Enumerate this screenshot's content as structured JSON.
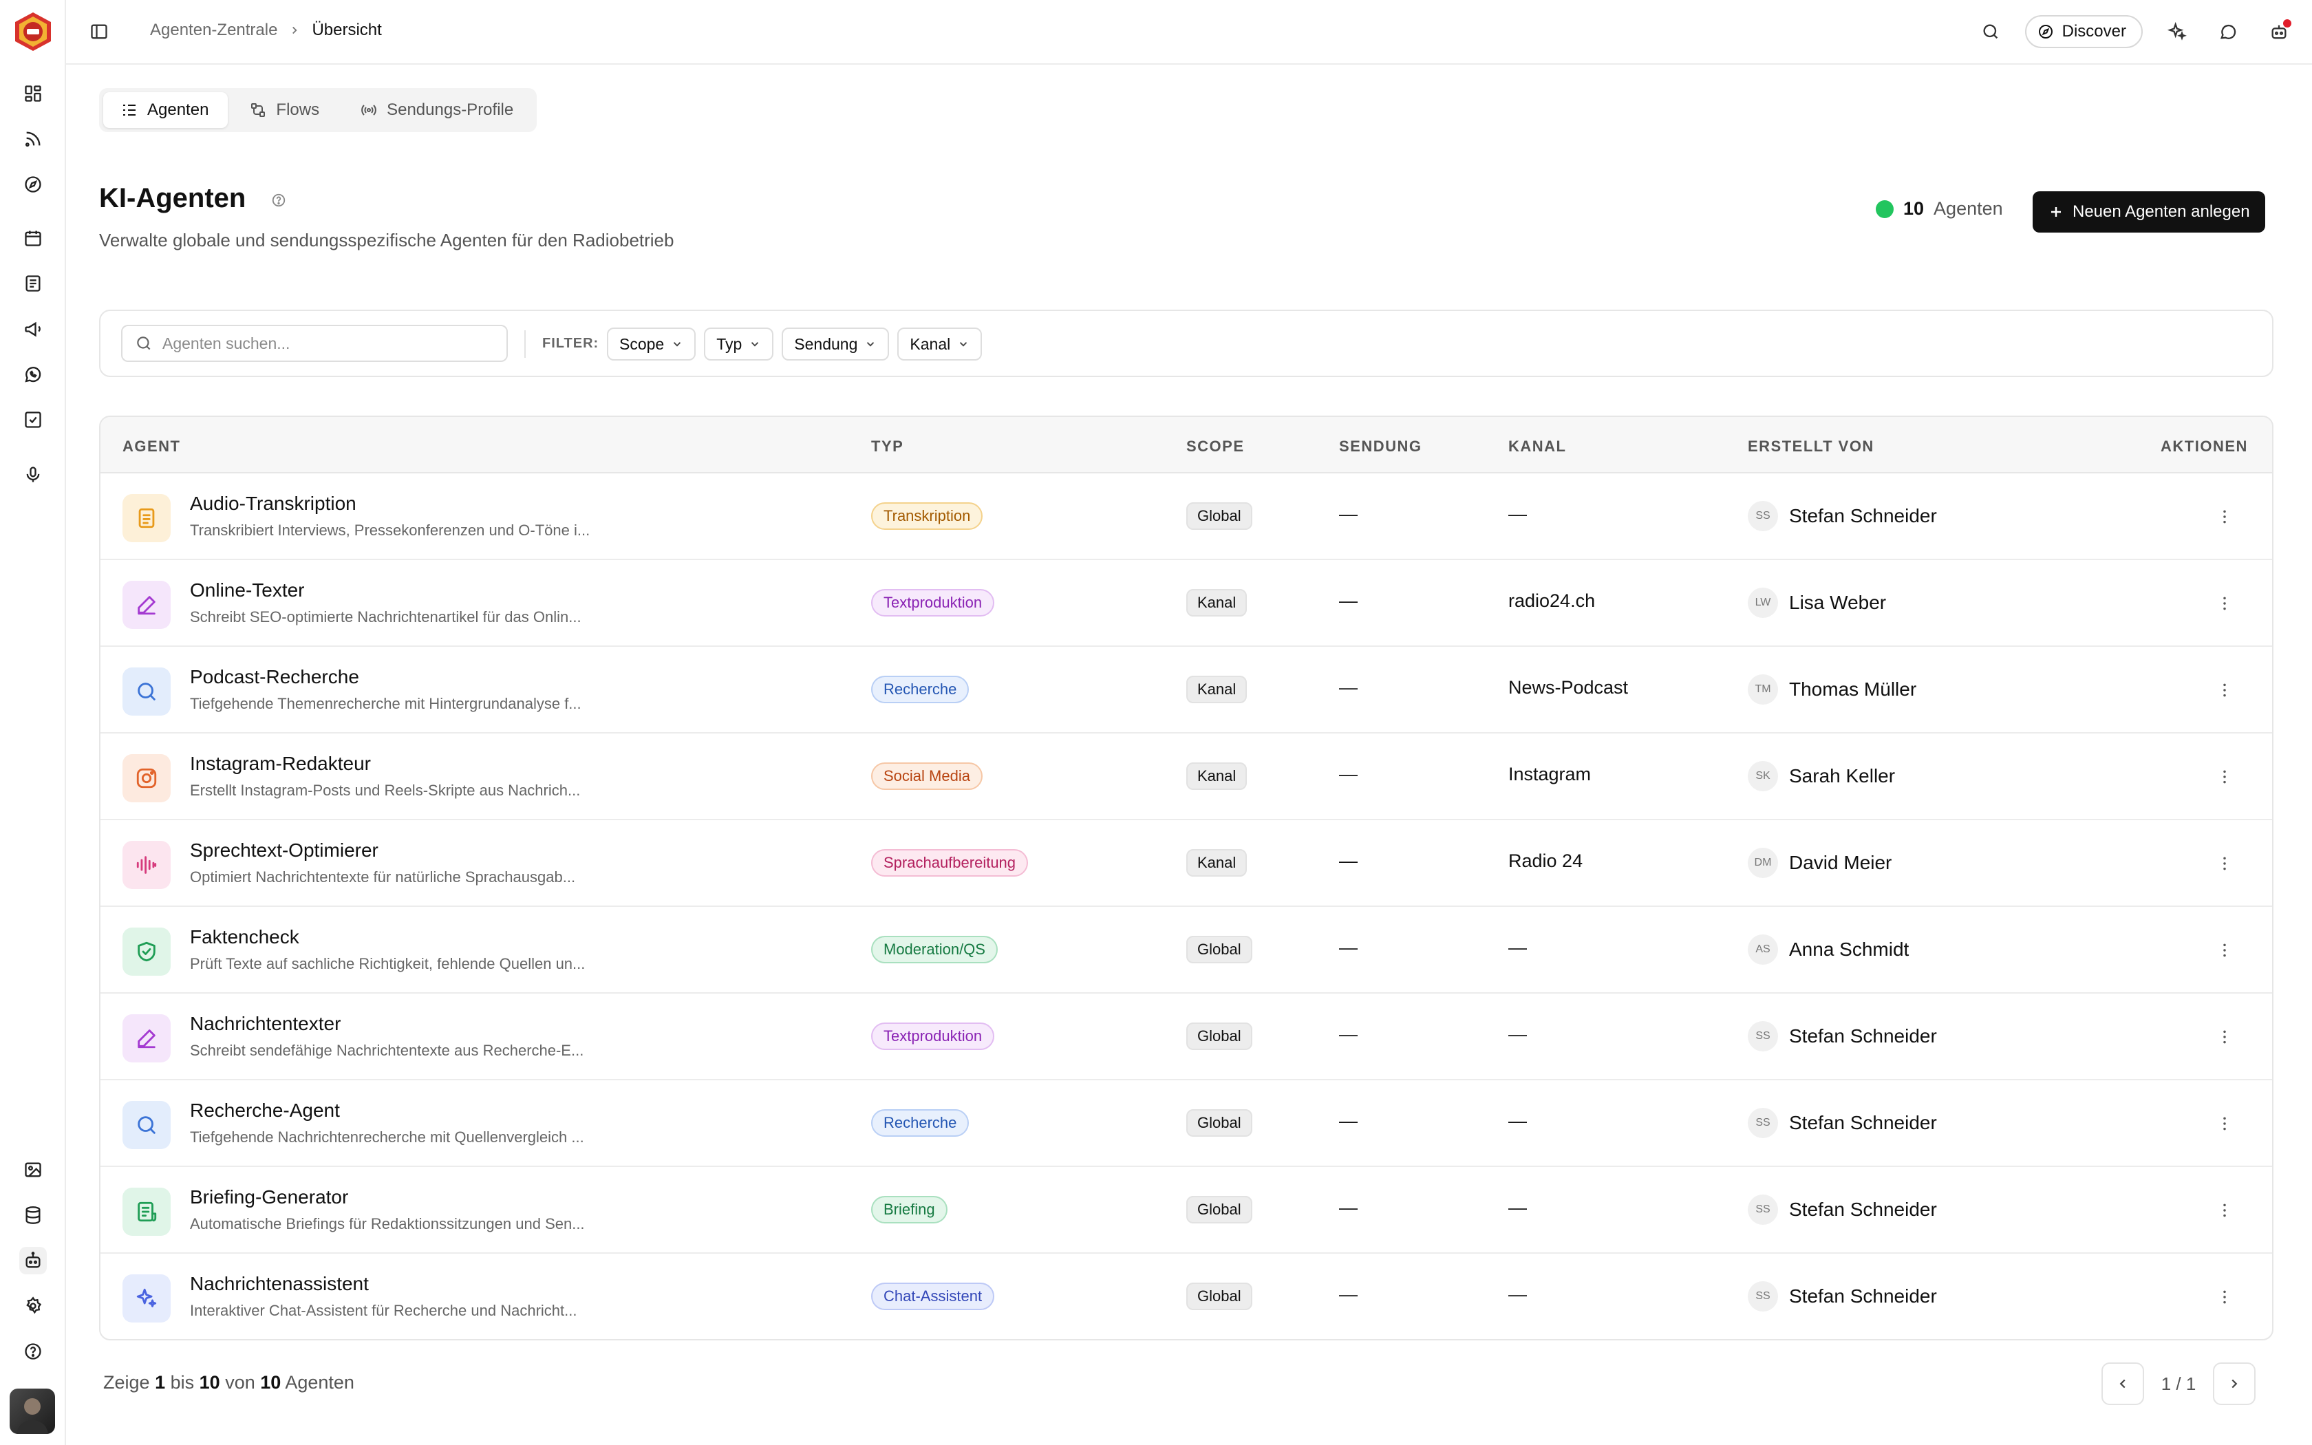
{
  "breadcrumb": {
    "parent": "Agenten-Zentrale",
    "current": "Übersicht"
  },
  "topbar": {
    "discover_label": "Discover"
  },
  "tabs": [
    {
      "label": "Agenten",
      "icon": "list-icon",
      "active": true
    },
    {
      "label": "Flows",
      "icon": "flow-icon",
      "active": false
    },
    {
      "label": "Sendungs-Profile",
      "icon": "broadcast-icon",
      "active": false
    }
  ],
  "header": {
    "title": "KI-Agenten",
    "subtitle": "Verwalte globale und sendungsspezifische Agenten für den Radiobetrieb",
    "count": "10",
    "count_label": "Agenten",
    "new_button": "Neuen Agenten anlegen"
  },
  "filters": {
    "search_placeholder": "Agenten suchen...",
    "label": "FILTER:",
    "chips": [
      "Scope",
      "Typ",
      "Sendung",
      "Kanal"
    ]
  },
  "table": {
    "columns": [
      "AGENT",
      "TYP",
      "SCOPE",
      "SENDUNG",
      "KANAL",
      "ERSTELLT VON",
      "AKTIONEN"
    ],
    "rows": [
      {
        "name": "Audio-Transkription",
        "desc": "Transkribiert Interviews, Pressekonferenzen und O-Töne i...",
        "icon": "document-icon",
        "icon_bg": "#fdf0d8",
        "icon_color": "#e89a1a",
        "type": "Transkription",
        "type_bg": "#fdf3dc",
        "type_border": "#f4d28c",
        "type_color": "#a35a00",
        "scope": "Global",
        "sendung": "—",
        "kanal": "—",
        "initials": "SS",
        "creator": "Stefan Schneider"
      },
      {
        "name": "Online-Texter",
        "desc": "Schreibt SEO-optimierte Nachrichtenartikel für das Onlin...",
        "icon": "pen-icon",
        "icon_bg": "#f5e6fb",
        "icon_color": "#a43ad1",
        "type": "Textproduktion",
        "type_bg": "#f7eafc",
        "type_border": "#e2bdf2",
        "type_color": "#8a23b4",
        "scope": "Kanal",
        "sendung": "—",
        "kanal": "radio24.ch",
        "initials": "LW",
        "creator": "Lisa Weber"
      },
      {
        "name": "Podcast-Recherche",
        "desc": "Tiefgehende Themenrecherche mit Hintergrundanalyse f...",
        "icon": "search-icon",
        "icon_bg": "#e3edfc",
        "icon_color": "#3b73d6",
        "type": "Recherche",
        "type_bg": "#e8f0fd",
        "type_border": "#b9cff5",
        "type_color": "#2456b3",
        "scope": "Kanal",
        "sendung": "—",
        "kanal": "News-Podcast",
        "initials": "TM",
        "creator": "Thomas Müller"
      },
      {
        "name": "Instagram-Redakteur",
        "desc": "Erstellt Instagram-Posts und Reels-Skripte aus Nachrich...",
        "icon": "instagram-icon",
        "icon_bg": "#fdeadf",
        "icon_color": "#e2632a",
        "type": "Social Media",
        "type_bg": "#fdeee3",
        "type_border": "#f6c7a6",
        "type_color": "#b84411",
        "scope": "Kanal",
        "sendung": "—",
        "kanal": "Instagram",
        "initials": "SK",
        "creator": "Sarah Keller"
      },
      {
        "name": "Sprechtext-Optimierer",
        "desc": "Optimiert Nachrichtentexte für natürliche Sprachausgab...",
        "icon": "audio-wave-icon",
        "icon_bg": "#fce5ef",
        "icon_color": "#d63a7c",
        "type": "Sprachaufbereitung",
        "type_bg": "#fde9f1",
        "type_border": "#f4bcd4",
        "type_color": "#b3205e",
        "scope": "Kanal",
        "sendung": "—",
        "kanal": "Radio 24",
        "initials": "DM",
        "creator": "David Meier"
      },
      {
        "name": "Faktencheck",
        "desc": "Prüft Texte auf sachliche Richtigkeit, fehlende Quellen un...",
        "icon": "shield-check-icon",
        "icon_bg": "#e0f5e8",
        "icon_color": "#1f9d55",
        "type": "Moderation/QS",
        "type_bg": "#e3f6ea",
        "type_border": "#a9e0bf",
        "type_color": "#167a42",
        "scope": "Global",
        "sendung": "—",
        "kanal": "—",
        "initials": "AS",
        "creator": "Anna Schmidt"
      },
      {
        "name": "Nachrichtentexter",
        "desc": "Schreibt sendefähige Nachrichtentexte aus Recherche-E...",
        "icon": "pen-icon",
        "icon_bg": "#f5e6fb",
        "icon_color": "#a43ad1",
        "type": "Textproduktion",
        "type_bg": "#f7eafc",
        "type_border": "#e2bdf2",
        "type_color": "#8a23b4",
        "scope": "Global",
        "sendung": "—",
        "kanal": "—",
        "initials": "SS",
        "creator": "Stefan Schneider"
      },
      {
        "name": "Recherche-Agent",
        "desc": "Tiefgehende Nachrichtenrecherche mit Quellenvergleich ...",
        "icon": "search-icon",
        "icon_bg": "#e3edfc",
        "icon_color": "#3b73d6",
        "type": "Recherche",
        "type_bg": "#e8f0fd",
        "type_border": "#b9cff5",
        "type_color": "#2456b3",
        "scope": "Global",
        "sendung": "—",
        "kanal": "—",
        "initials": "SS",
        "creator": "Stefan Schneider"
      },
      {
        "name": "Briefing-Generator",
        "desc": "Automatische Briefings für Redaktionssitzungen und Sen...",
        "icon": "briefing-icon",
        "icon_bg": "#e0f5e8",
        "icon_color": "#1f9d55",
        "type": "Briefing",
        "type_bg": "#e3f6ea",
        "type_border": "#a9e0bf",
        "type_color": "#167a42",
        "scope": "Global",
        "sendung": "—",
        "kanal": "—",
        "initials": "SS",
        "creator": "Stefan Schneider"
      },
      {
        "name": "Nachrichtenassistent",
        "desc": "Interaktiver Chat-Assistent für Recherche und Nachricht...",
        "icon": "sparkles-icon",
        "icon_bg": "#e6ecfd",
        "icon_color": "#4a63e0",
        "type": "Chat-Assistent",
        "type_bg": "#e8edfd",
        "type_border": "#bdc9f6",
        "type_color": "#3347b8",
        "scope": "Global",
        "sendung": "—",
        "kanal": "—",
        "initials": "SS",
        "creator": "Stefan Schneider"
      }
    ]
  },
  "footer": {
    "prefix": "Zeige",
    "from": "1",
    "mid1": "bis",
    "to": "10",
    "mid2": "von",
    "total": "10",
    "suffix": "Agenten",
    "page": "1 / 1"
  }
}
